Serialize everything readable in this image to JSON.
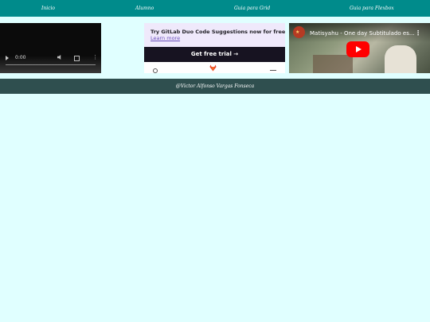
{
  "nav": {
    "items": [
      {
        "label": "Inicio"
      },
      {
        "label": "Alumno"
      },
      {
        "label": "Guia para Grid"
      },
      {
        "label": "Guia para Flexbox"
      }
    ],
    "background": "#008b8b"
  },
  "video_player": {
    "time": "0:00"
  },
  "ad": {
    "promo_title": "Try GitLab Duo Code Suggestions now for free",
    "promo_link": "Learn more",
    "cta": "Get free trial →"
  },
  "youtube": {
    "title": "Matisyahu - One day Subtitulado es..."
  },
  "footer": {
    "text": "@Victor Alfonso Vargas Fonseca",
    "background": "#2f4f4f"
  },
  "page": {
    "background": "#e0ffff"
  }
}
